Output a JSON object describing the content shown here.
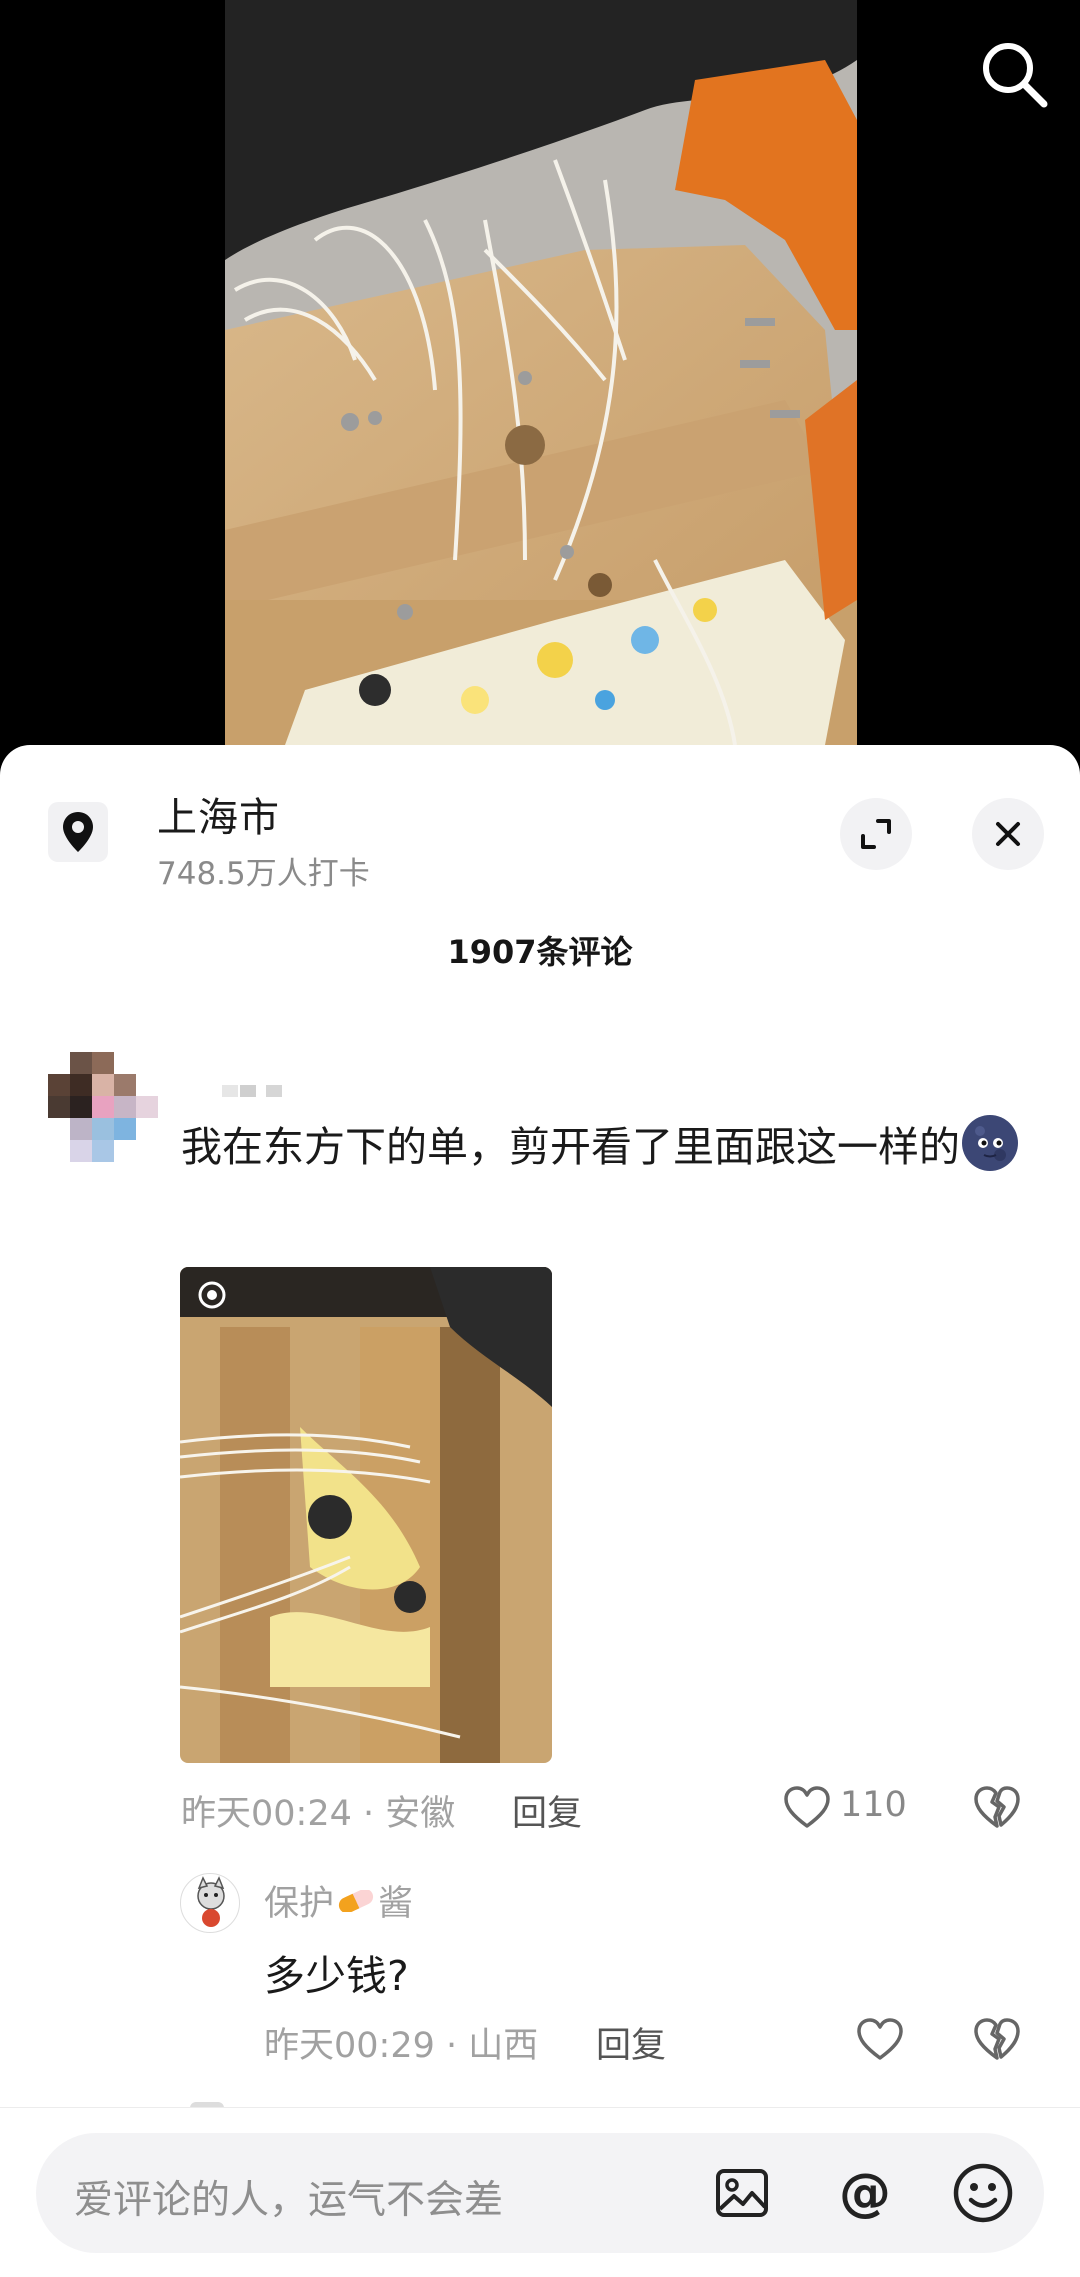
{
  "location": {
    "city": "上海市",
    "checkins": "748.5万人打卡"
  },
  "comments_header": {
    "count_label": "1907条评论"
  },
  "comment": {
    "text": "我在东方下的单，剪开看了里面跟这一样的",
    "time": "昨天00:24",
    "region": "安徽",
    "reply_label": "回复",
    "likes": "110"
  },
  "reply": {
    "username_prefix": "保护",
    "username_suffix": "酱",
    "text": "多少钱?",
    "time": "昨天00:29",
    "region": "山西",
    "reply_label": "回复"
  },
  "input": {
    "placeholder": "爱评论的人，运气不会差",
    "at_symbol": "@"
  },
  "icons": {
    "search": "search-icon",
    "location": "location-pin-icon",
    "expand": "expand-icon",
    "close": "close-icon",
    "like": "heart-icon",
    "dislike": "broken-heart-icon",
    "image": "image-icon",
    "emoji": "emoji-icon"
  },
  "colors": {
    "sheet_bg": "#ffffff",
    "muted_text": "#a1a1a1",
    "input_bg": "#f3f3f5"
  }
}
